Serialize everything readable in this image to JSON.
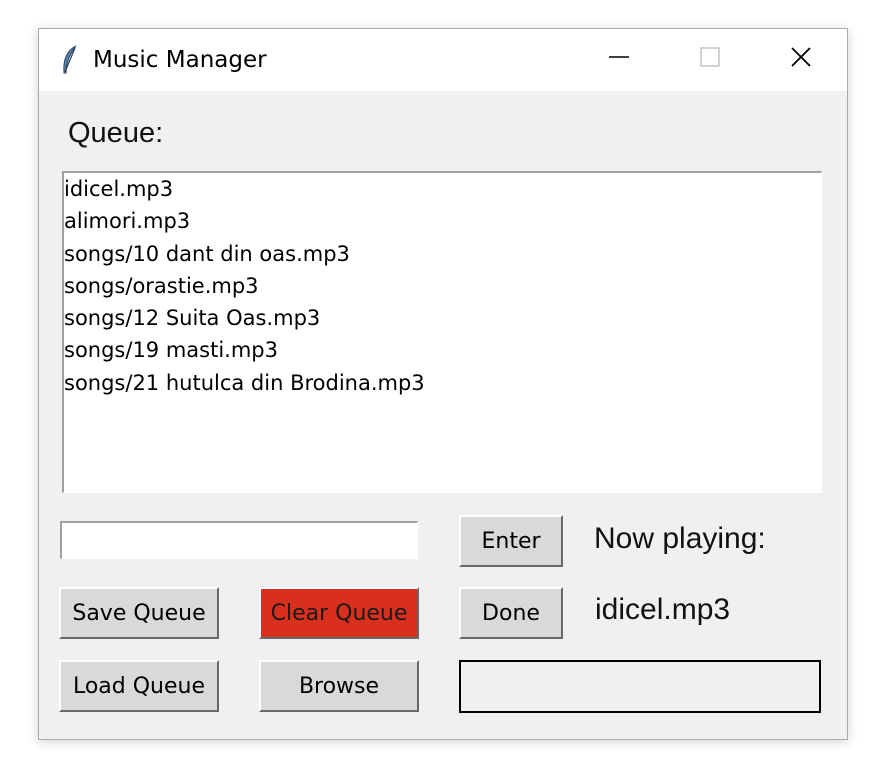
{
  "window": {
    "title": "Music Manager",
    "icon": "feather-icon",
    "controls": [
      "minimize-icon",
      "maximize-icon",
      "close-icon"
    ]
  },
  "queue": {
    "label": "Queue:",
    "items": [
      "idicel.mp3",
      "alimori.mp3",
      "songs/10 dant din oas.mp3",
      "songs/orastie.mp3",
      "songs/12 Suita Oas.mp3",
      "songs/19 masti.mp3",
      "songs/21 hutulca din Brodina.mp3"
    ]
  },
  "entry": {
    "value": ""
  },
  "buttons": {
    "enter": "Enter",
    "save_queue": "Save Queue",
    "clear_queue": "Clear Queue",
    "done": "Done",
    "load_queue": "Load Queue",
    "browse": "Browse"
  },
  "now_playing": {
    "label": "Now playing:",
    "value": "idicel.mp3"
  },
  "status": {
    "text": ""
  },
  "colors": {
    "window_bg": "#f0f0f0",
    "button_bg": "#d9d9d9",
    "clear_button_bg": "#d9301e"
  }
}
